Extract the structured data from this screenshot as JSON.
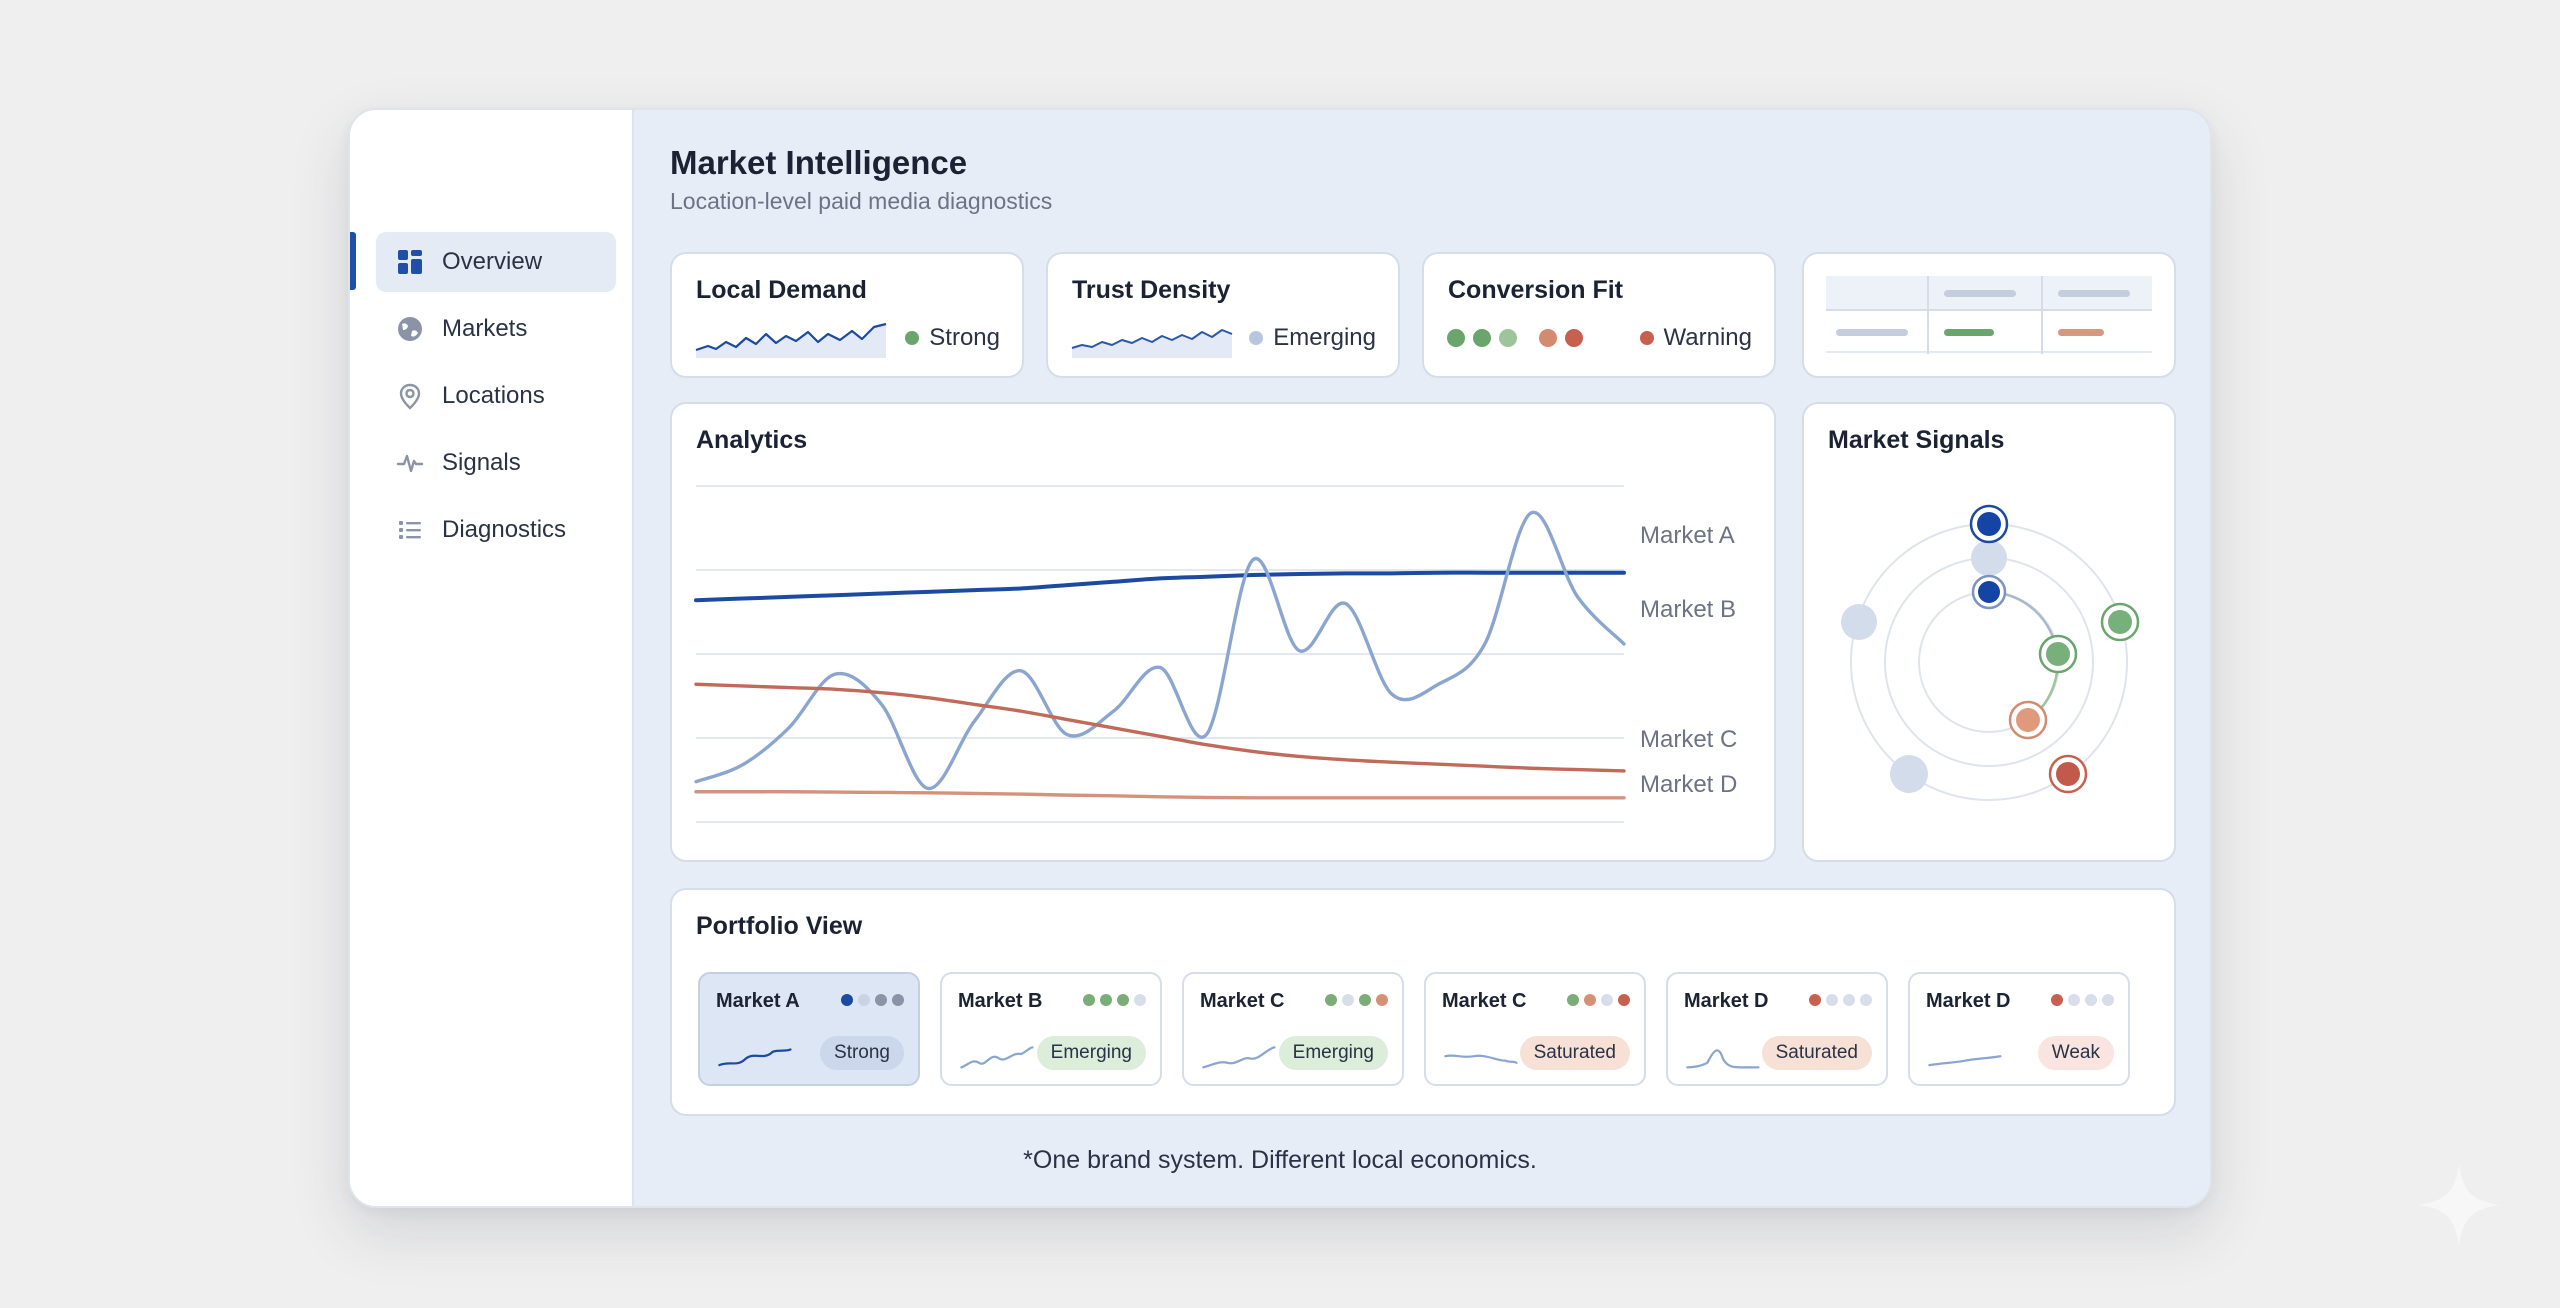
{
  "nav": {
    "items": [
      {
        "label": "Overview",
        "icon": "dashboard-icon",
        "active": true
      },
      {
        "label": "Markets",
        "icon": "globe-icon",
        "active": false
      },
      {
        "label": "Locations",
        "icon": "map-pin-icon",
        "active": false
      },
      {
        "label": "Signals",
        "icon": "pulse-icon",
        "active": false
      },
      {
        "label": "Diagnostics",
        "icon": "list-icon",
        "active": false
      }
    ]
  },
  "header": {
    "title": "Market Intelligence",
    "subtitle": "Location-level paid media diagnostics"
  },
  "kpis": [
    {
      "title": "Local Demand",
      "status": "Strong",
      "status_color": "#6aa56b"
    },
    {
      "title": "Trust Density",
      "status": "Emerging",
      "status_color": "#b9c7de"
    },
    {
      "title": "Conversion Fit",
      "status": "Warning",
      "status_color": "#c8604f",
      "indicator_colors": [
        "#6aa56b",
        "#6aa56b",
        "#9dc49a",
        "#d38a6f",
        "#c8604f"
      ]
    }
  ],
  "colors": {
    "market_a": "#1c4aa0",
    "market_b": "#8aa5d0",
    "market_c": "#c26a5a",
    "market_d": "#d4927c",
    "green": "#6aa56b",
    "red": "#c8604f",
    "accent": "#1f4fa8"
  },
  "analytics": {
    "title": "Analytics",
    "chart_data": {
      "type": "line",
      "x": [
        0,
        1,
        2,
        3,
        4,
        5,
        6,
        7,
        8,
        9,
        10,
        11,
        12,
        13,
        14,
        15,
        16,
        17,
        18,
        19,
        20
      ],
      "series": [
        {
          "name": "Market A",
          "values": [
            6.6,
            6.65,
            6.7,
            6.75,
            6.8,
            6.85,
            6.9,
            6.95,
            7.05,
            7.15,
            7.25,
            7.3,
            7.35,
            7.38,
            7.4,
            7.4,
            7.42,
            7.42,
            7.42,
            7.42,
            7.42
          ]
        },
        {
          "name": "Market B",
          "values": [
            1.2,
            1.7,
            2.8,
            4.4,
            3.5,
            1.0,
            3.0,
            4.5,
            2.6,
            3.3,
            4.6,
            2.6,
            7.8,
            5.1,
            6.5,
            3.8,
            4.1,
            5.3,
            9.2,
            6.7,
            5.3
          ]
        },
        {
          "name": "Market C",
          "values": [
            4.1,
            4.05,
            4.0,
            3.95,
            3.85,
            3.7,
            3.5,
            3.3,
            3.05,
            2.8,
            2.55,
            2.3,
            2.1,
            1.95,
            1.85,
            1.78,
            1.72,
            1.66,
            1.6,
            1.56,
            1.52
          ]
        },
        {
          "name": "Market D",
          "values": [
            0.9,
            0.9,
            0.9,
            0.89,
            0.88,
            0.87,
            0.85,
            0.83,
            0.8,
            0.78,
            0.75,
            0.73,
            0.72,
            0.72,
            0.72,
            0.72,
            0.72,
            0.72,
            0.72,
            0.72,
            0.72
          ]
        }
      ],
      "ylim": [
        0,
        10
      ],
      "grid": true,
      "legend": "right"
    }
  },
  "signals": {
    "title": "Market Signals"
  },
  "portfolio": {
    "title": "Portfolio View",
    "markets": [
      {
        "name": "Market A",
        "status": "Strong",
        "badge_bg": "#cbd7ea",
        "selected": true,
        "dots": [
          "#1c4aa0",
          "#c9d3e3",
          "#8a94a6",
          "#8a94a6"
        ],
        "line_color": "#1c4aa0"
      },
      {
        "name": "Market B",
        "status": "Emerging",
        "badge_bg": "#dcedd9",
        "selected": false,
        "dots": [
          "#7aad78",
          "#7aad78",
          "#7aad78",
          "#d7deea"
        ],
        "line_color": "#8aa5d0"
      },
      {
        "name": "Market C",
        "status": "Emerging",
        "badge_bg": "#dcedd9",
        "selected": false,
        "dots": [
          "#7aad78",
          "#d7deea",
          "#7aad78",
          "#d89074"
        ],
        "line_color": "#8aa5d0"
      },
      {
        "name": "Market C",
        "status": "Saturated",
        "badge_bg": "#f7e1d6",
        "selected": false,
        "dots": [
          "#7aad78",
          "#d89074",
          "#d7deea",
          "#c8604f"
        ],
        "line_color": "#8aa5d0"
      },
      {
        "name": "Market D",
        "status": "Saturated",
        "badge_bg": "#f7e1d6",
        "selected": false,
        "dots": [
          "#c8604f",
          "#d7deea",
          "#d7deea",
          "#d7deea"
        ],
        "line_color": "#8aa5d0"
      },
      {
        "name": "Market D",
        "status": "Weak",
        "badge_bg": "#f9e4df",
        "selected": false,
        "dots": [
          "#c8604f",
          "#d7deea",
          "#d7deea",
          "#d7deea"
        ],
        "line_color": "#8aa5d0"
      }
    ]
  },
  "footer": {
    "note": "*One brand system. Different local economics."
  }
}
